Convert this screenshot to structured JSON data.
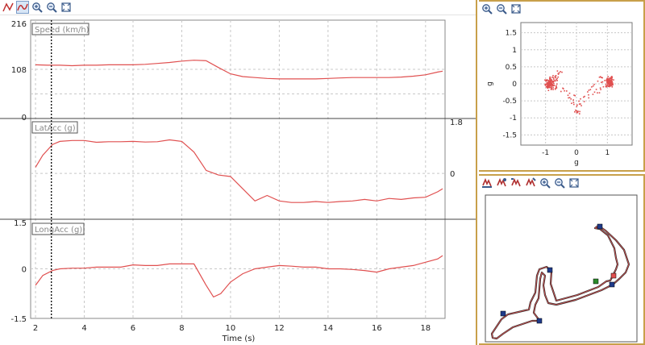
{
  "toolbar_main": {
    "icons": [
      "line-mode-icon",
      "curve-mode-icon",
      "zoom-in-icon",
      "zoom-out-icon",
      "fit-view-icon"
    ]
  },
  "toolbar_scatter": {
    "icons": [
      "zoom-in-icon",
      "zoom-out-icon",
      "fit-view-icon"
    ]
  },
  "toolbar_track": {
    "icons": [
      "track-icon-1",
      "track-icon-2",
      "track-icon-3",
      "track-icon-4",
      "zoom-in-icon",
      "zoom-out-icon",
      "fit-view-icon"
    ]
  },
  "colors": {
    "trace": "#e05050",
    "grid": "#c8c8c8",
    "accent_border": "#c8a04a",
    "marker": "#1f3a8a",
    "marker_green": "#2a8a2a"
  },
  "chart_data": [
    {
      "type": "line",
      "title": "Speed (km/h)",
      "yticks": [
        "216",
        "108",
        "0"
      ],
      "ylim": [
        0,
        216
      ],
      "x": [
        2,
        2.5,
        3,
        3.5,
        4,
        4.5,
        5,
        5.5,
        6,
        6.5,
        7,
        7.5,
        8,
        8.5,
        9,
        9.5,
        10,
        10.5,
        11,
        11.5,
        12,
        12.5,
        13,
        13.5,
        14,
        14.5,
        15,
        15.5,
        16,
        16.5,
        17,
        17.5,
        18,
        18.5,
        18.7
      ],
      "values": [
        118,
        117,
        117,
        116,
        117,
        117,
        118,
        118,
        118,
        119,
        121,
        123,
        126,
        128,
        127,
        112,
        98,
        92,
        90,
        88,
        87,
        87,
        87,
        87,
        88,
        89,
        90,
        90,
        90,
        90,
        91,
        93,
        96,
        102,
        104
      ]
    },
    {
      "type": "line",
      "title": "LatAcc (g)",
      "yticks": [
        "1.8",
        "0"
      ],
      "ylim": [
        -1.5,
        1.8
      ],
      "x": [
        2,
        2.3,
        2.7,
        3,
        3.5,
        4,
        4.5,
        5,
        5.5,
        6,
        6.5,
        7,
        7.5,
        8,
        8.5,
        9,
        9.5,
        10,
        10.5,
        11,
        11.5,
        12,
        12.5,
        13,
        13.5,
        14,
        14.5,
        15,
        15.5,
        16,
        16.5,
        17,
        17.5,
        18,
        18.5,
        18.7
      ],
      "values": [
        0.2,
        0.6,
        0.95,
        1.05,
        1.08,
        1.08,
        1.02,
        1.04,
        1.04,
        1.05,
        1.03,
        1.04,
        1.1,
        1.05,
        0.7,
        0.1,
        -0.05,
        -0.1,
        -0.5,
        -0.9,
        -0.72,
        -0.9,
        -0.95,
        -0.95,
        -0.92,
        -0.95,
        -0.92,
        -0.9,
        -0.85,
        -0.9,
        -0.82,
        -0.85,
        -0.8,
        -0.78,
        -0.6,
        -0.5
      ]
    },
    {
      "type": "line",
      "title": "LongAcc (g)",
      "yticks": [
        "1.5",
        "0",
        "-1.5"
      ],
      "ylim": [
        -1.5,
        1.5
      ],
      "xlabel": "Time (s)",
      "xticks": [
        "2",
        "4",
        "6",
        "8",
        "10",
        "12",
        "14",
        "16",
        "18"
      ],
      "x": [
        2,
        2.3,
        2.7,
        3,
        3.5,
        4,
        4.5,
        5,
        5.5,
        6,
        6.5,
        7,
        7.5,
        8,
        8.5,
        9,
        9.3,
        9.6,
        10,
        10.5,
        11,
        11.5,
        12,
        12.5,
        13,
        13.5,
        14,
        14.5,
        15,
        15.5,
        16,
        16.5,
        17,
        17.5,
        18,
        18.5,
        18.7
      ],
      "values": [
        -0.5,
        -0.2,
        -0.05,
        0.0,
        0.02,
        0.02,
        0.05,
        0.05,
        0.05,
        0.12,
        0.1,
        0.1,
        0.15,
        0.15,
        0.15,
        -0.5,
        -0.85,
        -0.75,
        -0.4,
        -0.15,
        0.0,
        0.05,
        0.1,
        0.08,
        0.05,
        0.05,
        0.0,
        0.0,
        -0.02,
        -0.05,
        -0.1,
        0.0,
        0.05,
        0.1,
        0.2,
        0.3,
        0.4
      ]
    },
    {
      "type": "scatter",
      "xlabel": "g",
      "ylabel": "g",
      "yticks": [
        "1.5",
        "1",
        "0.5",
        "0",
        "-0.5",
        "-1",
        "-1.5"
      ],
      "xticks": [
        "-1",
        "0",
        "1"
      ],
      "xlim": [
        -1.8,
        1.8
      ],
      "ylim": [
        -1.8,
        1.8
      ]
    }
  ],
  "cursor": {
    "time": 2.65
  },
  "track": {
    "markers": 7
  }
}
